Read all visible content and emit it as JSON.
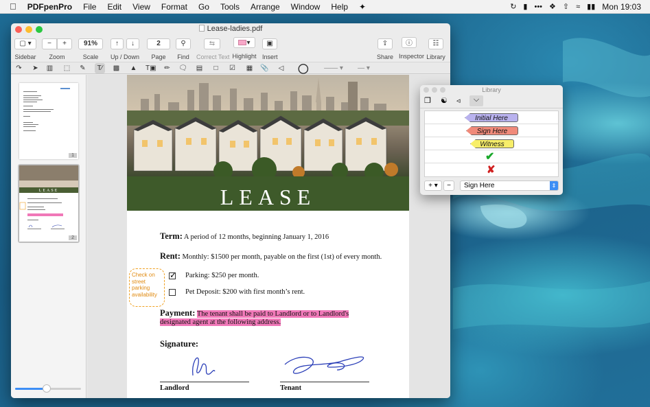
{
  "menubar": {
    "app": "PDFpenPro",
    "items": [
      "File",
      "Edit",
      "View",
      "Format",
      "Go",
      "Tools",
      "Arrange",
      "Window",
      "Help"
    ],
    "clock": "Mon 19:03"
  },
  "window": {
    "title": "Lease-ladies.pdf",
    "toolbar": {
      "sidebar": "Sidebar",
      "zoom": "Zoom",
      "scale": "Scale",
      "scale_value": "91%",
      "updown": "Up / Down",
      "page": "Page",
      "page_value": "2",
      "find": "Find",
      "correct_text": "Correct Text",
      "highlight": "Highlight",
      "insert": "Insert",
      "share": "Share",
      "inspector": "Inspector",
      "library": "Library"
    },
    "thumbnails": [
      {
        "page": "1"
      },
      {
        "page": "2"
      }
    ],
    "document": {
      "heading": "LEASE",
      "term_label": "Term:",
      "term_text": "A period of 12 months, beginning January 1, 2016",
      "rent_label": "Rent:",
      "rent_text": "Monthly: $1500 per month, payable on the first (1st) of every month.",
      "parking": "Parking: $250 per month.",
      "parking_checked": true,
      "deposit": "Pet Deposit: $200 with first month’s rent.",
      "deposit_checked": false,
      "payment_label": "Payment:",
      "payment_line1": "The tenant shall be paid to Landlord or to Landlord's",
      "payment_line2": "designated agent at the following address.",
      "signature_label": "Signature:",
      "landlord": "Landlord",
      "tenant": "Tenant",
      "callout": "Check on street parking availability",
      "callout_lines": [
        "Check on",
        "street",
        "parking",
        "availability"
      ]
    }
  },
  "library": {
    "title": "Library",
    "stamps": [
      {
        "label": "Initial Here",
        "color": "#b9b2ee"
      },
      {
        "label": "Sign Here",
        "color": "#f08a7a"
      },
      {
        "label": "Witness",
        "color": "#f7ee6a"
      }
    ],
    "footer": {
      "add": "+",
      "remove": "−",
      "select_value": "Sign Here"
    }
  },
  "colors": {
    "highlight": "#f078b8",
    "callout": "#f0a020",
    "check": "#1aa82a",
    "cross": "#d02020"
  }
}
